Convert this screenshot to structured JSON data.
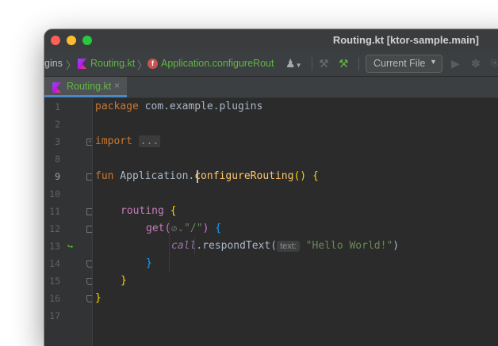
{
  "window": {
    "title": "Routing.kt [ktor-sample.main]"
  },
  "navbar": {
    "crumb_truncated": "gins",
    "crumb_file": "Routing.kt",
    "crumb_function": "Application.configureRout",
    "function_icon_letter": "f",
    "run_config": "Current File"
  },
  "tabs": [
    {
      "label": "Routing.kt",
      "close": "×"
    }
  ],
  "editor": {
    "line_numbers": [
      "1",
      "2",
      "3",
      "8",
      "9",
      "10",
      "11",
      "12",
      "13",
      "14",
      "15",
      "16",
      "17"
    ],
    "code": {
      "l1_kw": "package",
      "l1_rest": " com.example.plugins",
      "l3_kw": "import",
      "l3_collapsed": "...",
      "l9_kw": "fun",
      "l9_receiver": " Application.",
      "l9_name": "configureRouting",
      "l9_parens": "()",
      "l9_brace": " {",
      "l11_call": "routing",
      "l11_brace": " {",
      "l12_call": "get",
      "l12_paren_open": "(",
      "l12_hint": "⊘⌄",
      "l12_str": "\"/\"",
      "l12_paren_close": ")",
      "l12_brace": " {",
      "l13_call": "call",
      "l13_method": ".respondText(",
      "l13_hint": "text:",
      "l13_str": " \"Hello World!\"",
      "l13_close": ")",
      "l14_brace": "}",
      "l15_brace": "}",
      "l16_brace": "}"
    }
  },
  "colors": {
    "editor_bg": "#2b2b2b",
    "keyword": "#cc7832",
    "function_decl": "#ffc66d",
    "string": "#6a8759",
    "accent_tab": "#4a88c7",
    "file_green": "#62b543"
  }
}
